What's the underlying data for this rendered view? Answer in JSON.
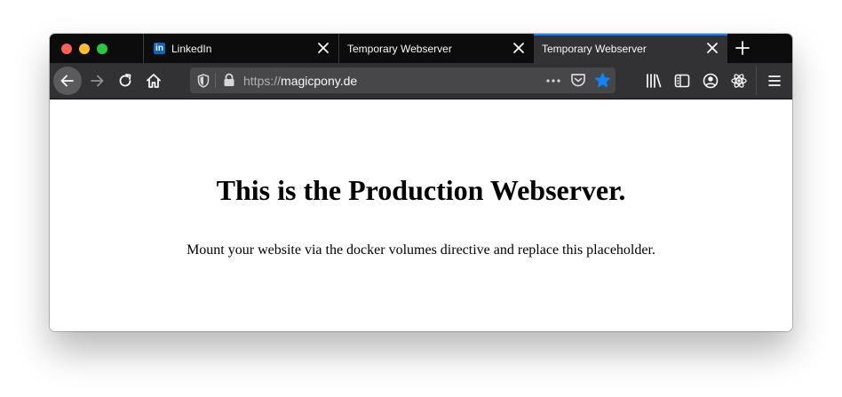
{
  "browser": {
    "tabs": [
      {
        "title": "LinkedIn",
        "favicon": "linkedin-icon",
        "active": false
      },
      {
        "title": "Temporary Webserver",
        "active": false
      },
      {
        "title": "Temporary Webserver",
        "active": true
      }
    ],
    "url": {
      "scheme": "https://",
      "host": "magicpony.de"
    },
    "icons": {
      "back": "arrow-left-icon",
      "forward": "arrow-right-icon",
      "reload": "reload-icon",
      "home": "home-icon",
      "tracking": "shield-icon",
      "secure": "lock-icon",
      "page_actions": "more-dots-icon",
      "pocket": "pocket-icon",
      "bookmark": "star-icon",
      "library": "library-icon",
      "sidebar": "sidebar-icon",
      "account": "account-icon",
      "extension": "react-icon",
      "menu": "hamburger-menu-icon"
    },
    "colors": {
      "tabstrip": "#0c0c0d",
      "toolbar": "#323234",
      "active_tab_accent": "#0a84ff",
      "bookmark_star": "#0a84ff",
      "linkedin": "#0a66c2"
    }
  },
  "page": {
    "heading": "This is the Production Webserver.",
    "text": "Mount your website via the docker volumes directive and replace this placeholder."
  }
}
